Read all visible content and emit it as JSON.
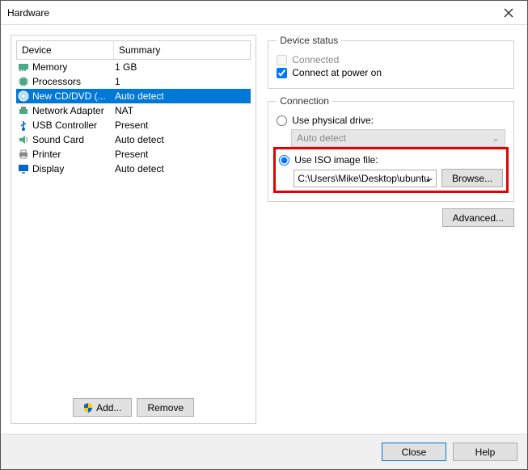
{
  "window": {
    "title": "Hardware"
  },
  "table": {
    "head_device": "Device",
    "head_summary": "Summary"
  },
  "rows": [
    {
      "name": "Memory",
      "summary": "1 GB",
      "selected": false,
      "icon": "memory"
    },
    {
      "name": "Processors",
      "summary": "1",
      "selected": false,
      "icon": "cpu"
    },
    {
      "name": "New CD/DVD (...",
      "summary": "Auto detect",
      "selected": true,
      "icon": "cd"
    },
    {
      "name": "Network Adapter",
      "summary": "NAT",
      "selected": false,
      "icon": "net"
    },
    {
      "name": "USB Controller",
      "summary": "Present",
      "selected": false,
      "icon": "usb"
    },
    {
      "name": "Sound Card",
      "summary": "Auto detect",
      "selected": false,
      "icon": "sound"
    },
    {
      "name": "Printer",
      "summary": "Present",
      "selected": false,
      "icon": "printer"
    },
    {
      "name": "Display",
      "summary": "Auto detect",
      "selected": false,
      "icon": "display"
    }
  ],
  "buttons": {
    "add": "Add...",
    "remove": "Remove",
    "browse": "Browse...",
    "advanced": "Advanced...",
    "close": "Close",
    "help": "Help"
  },
  "status": {
    "legend": "Device status",
    "connected_label": "Connected",
    "connected": false,
    "connect_power_label": "Connect at power on",
    "connect_power": true
  },
  "connection": {
    "legend": "Connection",
    "phys_label": "Use physical drive:",
    "phys_combo": "Auto detect",
    "iso_label": "Use ISO image file:",
    "iso_path": "C:\\Users\\Mike\\Desktop\\ubuntu-",
    "selected": "iso"
  }
}
